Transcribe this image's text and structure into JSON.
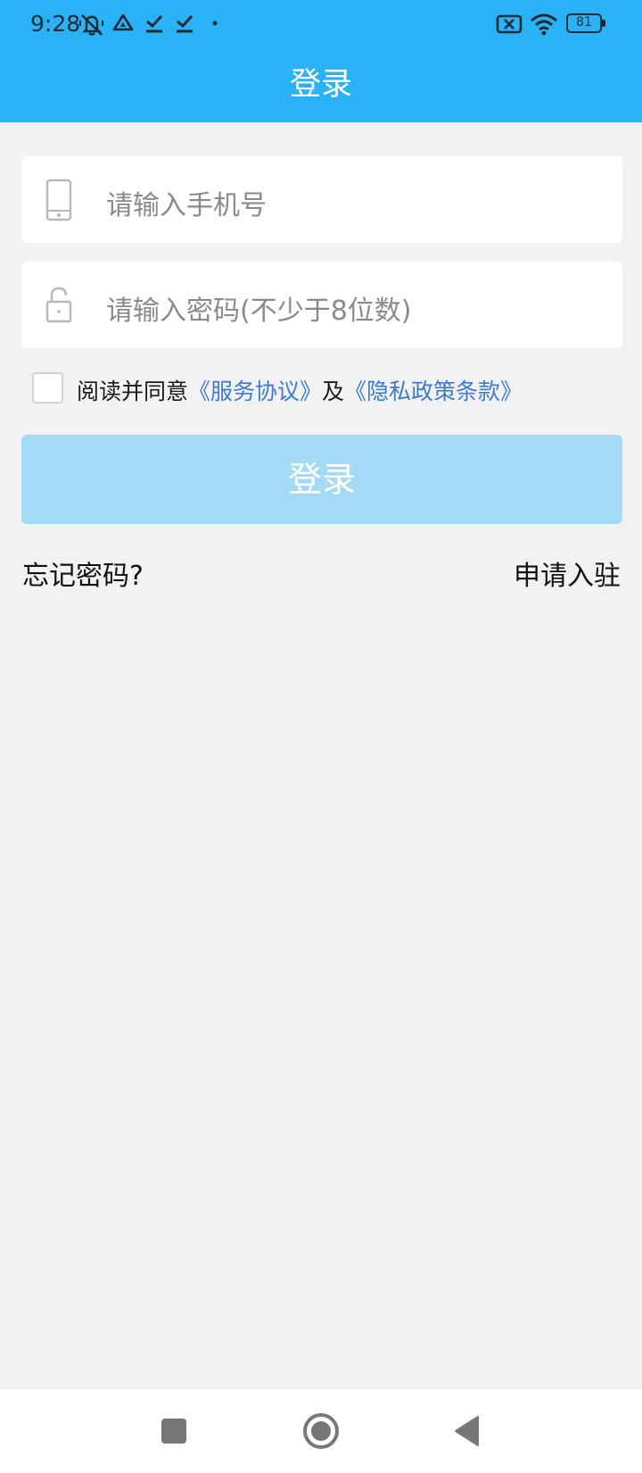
{
  "status_bar": {
    "time": "9:28",
    "battery": "81",
    "icons": [
      "mute-icon",
      "drive-icon",
      "download-done-icon",
      "download-done-icon",
      "dot-icon",
      "no-sim-icon",
      "wifi-icon",
      "battery-icon"
    ]
  },
  "header": {
    "title": "登录"
  },
  "form": {
    "phone": {
      "placeholder": "请输入手机号",
      "icon": "phone-icon"
    },
    "password": {
      "placeholder": "请输入密码(不少于8位数)",
      "icon": "lock-icon"
    },
    "agreement": {
      "prefix": "阅读并同意",
      "service_link": "《服务协议》",
      "connector": "及",
      "privacy_link": "《隐私政策条款》",
      "checked": false
    },
    "login_button": "登录",
    "forgot_password": "忘记密码?",
    "apply": "申请入驻"
  },
  "colors": {
    "header_bg": "#29b3f6",
    "button_disabled_bg": "#a3daf6",
    "link": "#3e7bd0",
    "page_bg": "#f2f2f2"
  },
  "nav_bar": {
    "icons": [
      "recents-icon",
      "home-icon",
      "back-icon"
    ]
  }
}
